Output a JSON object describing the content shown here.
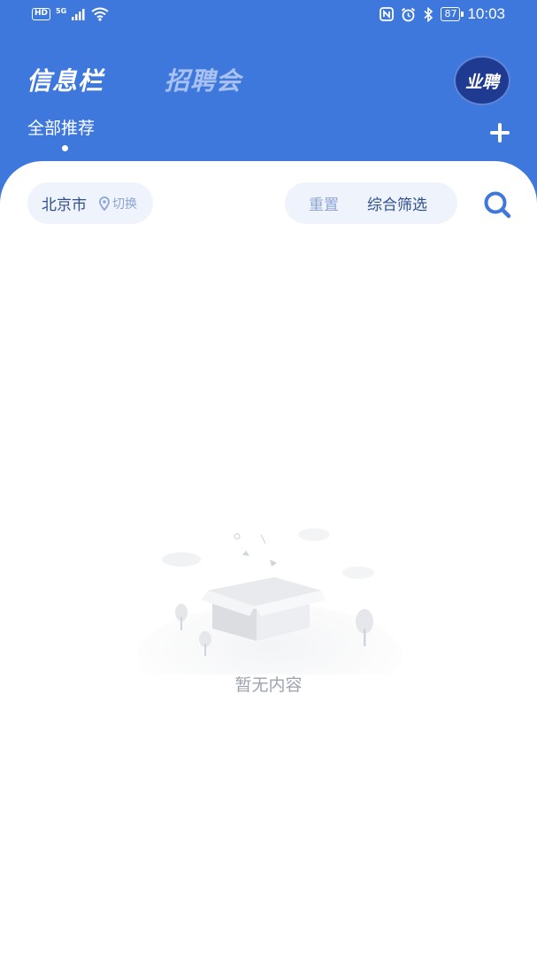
{
  "status_bar": {
    "left_badges": [
      "HD",
      "5G"
    ],
    "battery": "87",
    "time": "10:03",
    "icons": [
      "signal-icon",
      "wifi-icon",
      "nfc-icon",
      "alarm-icon",
      "bluetooth-icon",
      "battery-icon"
    ]
  },
  "header": {
    "tabs": [
      {
        "label": "信息栏",
        "active": true
      },
      {
        "label": "招聘会",
        "active": false
      }
    ],
    "logo_text": "业聘",
    "sub_tab": "全部推荐",
    "add_icon": "plus-icon"
  },
  "filters": {
    "city": "北京市",
    "switch_label": "切换",
    "reset_label": "重置",
    "filter_label": "综合筛选",
    "search_icon": "search-icon"
  },
  "empty_state": {
    "message": "暂无内容",
    "illustration": "empty-box-icon"
  },
  "colors": {
    "primary": "#3f78dc",
    "pill_bg": "#eff4fc",
    "text_dark": "#2f4f8f",
    "text_muted": "#8ca5d6"
  }
}
